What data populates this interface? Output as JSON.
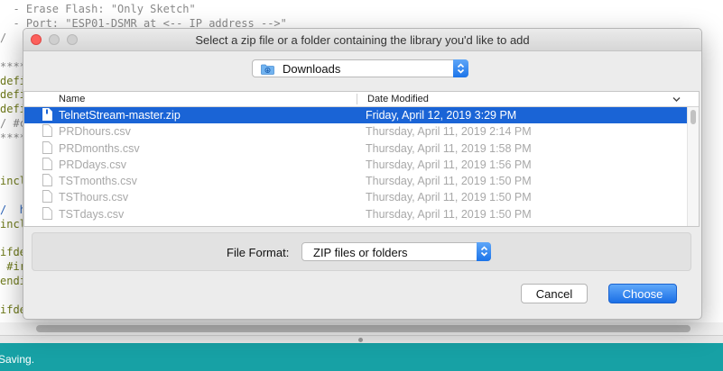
{
  "editor": {
    "lines": [
      {
        "text": "  - Erase Flash: \"Only Sketch\"",
        "cls": "c-gray"
      },
      {
        "text": "  - Port: \"ESP01-DSMR at <-- IP address -->\"",
        "cls": "c-gray"
      },
      {
        "text": "/",
        "cls": "c-gray"
      },
      {
        "text": "",
        "cls": ""
      },
      {
        "text": "****",
        "cls": "c-gray"
      },
      {
        "text": "defi",
        "cls": "c-olive"
      },
      {
        "text": "defi",
        "cls": "c-olive"
      },
      {
        "text": "defi",
        "cls": "c-olive"
      },
      {
        "text": "/ #c",
        "cls": "c-gray"
      },
      {
        "text": "****",
        "cls": "c-gray"
      },
      {
        "text": "",
        "cls": ""
      },
      {
        "text": "",
        "cls": ""
      },
      {
        "text": "incl",
        "cls": "c-olive"
      },
      {
        "text": "",
        "cls": ""
      },
      {
        "text": "/  h",
        "cls": "c-blue"
      },
      {
        "text": "incl",
        "cls": "c-olive"
      },
      {
        "text": "",
        "cls": ""
      },
      {
        "text": "ifde",
        "cls": "c-olive"
      },
      {
        "text": " #ir",
        "cls": "c-olive"
      },
      {
        "text": "endi",
        "cls": "c-olive"
      },
      {
        "text": "",
        "cls": ""
      },
      {
        "text": "ifde",
        "cls": "c-olive"
      }
    ]
  },
  "status_bar": {
    "text": "Saving."
  },
  "dialog": {
    "title": "Select a zip file or a folder containing the library you'd like to add",
    "location": "Downloads",
    "columns": {
      "name": "Name",
      "date": "Date Modified"
    },
    "files": [
      {
        "name": "TelnetStream-master.zip",
        "date": "Friday, April 12, 2019 3:29 PM",
        "state": "selected"
      },
      {
        "name": "PRDhours.csv",
        "date": "Thursday, April 11, 2019 2:14 PM",
        "state": "disabled"
      },
      {
        "name": "PRDmonths.csv",
        "date": "Thursday, April 11, 2019 1:58 PM",
        "state": "disabled"
      },
      {
        "name": "PRDdays.csv",
        "date": "Thursday, April 11, 2019 1:56 PM",
        "state": "disabled"
      },
      {
        "name": "TSTmonths.csv",
        "date": "Thursday, April 11, 2019 1:50 PM",
        "state": "disabled"
      },
      {
        "name": "TSThours.csv",
        "date": "Thursday, April 11, 2019 1:50 PM",
        "state": "disabled"
      },
      {
        "name": "TSTdays.csv",
        "date": "Thursday, April 11, 2019 1:50 PM",
        "state": "disabled"
      }
    ],
    "file_format_label": "File Format:",
    "file_format_value": "ZIP files or folders",
    "cancel_label": "Cancel",
    "choose_label": "Choose",
    "colors": {
      "accent": "#1a64d6",
      "status_bar": "#17a1a5",
      "close": "#fc605c"
    }
  }
}
